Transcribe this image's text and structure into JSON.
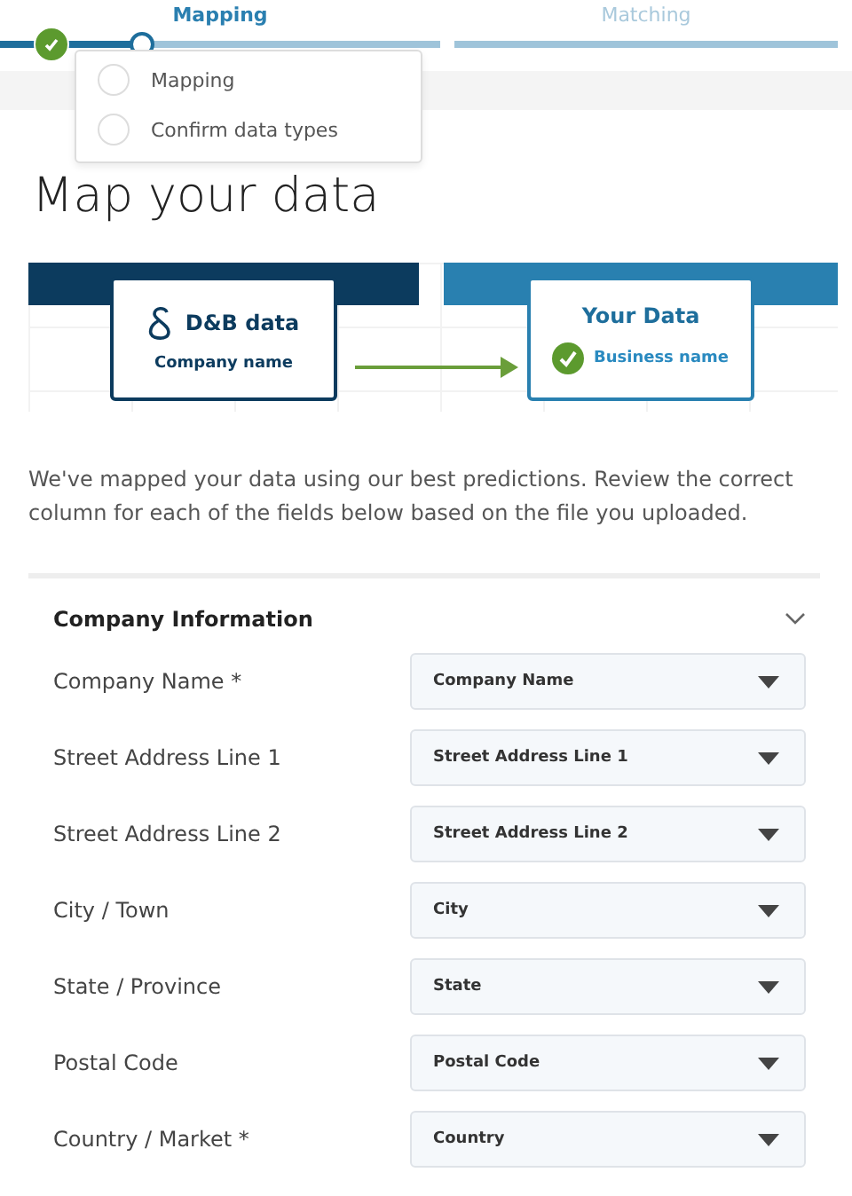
{
  "stepper": {
    "steps": [
      {
        "label": "Mapping",
        "selected": true,
        "level": 0.32
      },
      {
        "label": "Matching",
        "selected": false
      }
    ]
  },
  "substeps_popup": {
    "items": [
      {
        "label": "Mapping",
        "checked": false
      },
      {
        "label": "Confirm data types",
        "checked": false
      }
    ]
  },
  "title": "Map your data",
  "diagram": {
    "source": {
      "title": "D&B data",
      "field": "Company name"
    },
    "target": {
      "title": "Your Data",
      "field": "Business name",
      "matched": true
    }
  },
  "intro": "We've mapped your data using our best predictions. Review the correct column for each of the fields below based on the file you uploaded.",
  "section": {
    "title": "Company Information",
    "expanded": true,
    "fields": [
      {
        "label": "Company Name *",
        "value": "Company Name"
      },
      {
        "label": "Street Address Line 1",
        "value": "Street Address Line 1"
      },
      {
        "label": "Street Address Line 2",
        "value": "Street Address Line 2"
      },
      {
        "label": "City / Town",
        "value": "City"
      },
      {
        "label": "State / Province",
        "value": "State"
      },
      {
        "label": "Postal Code",
        "value": "Postal Code"
      },
      {
        "label": "Country / Market *",
        "value": "Country"
      }
    ]
  }
}
